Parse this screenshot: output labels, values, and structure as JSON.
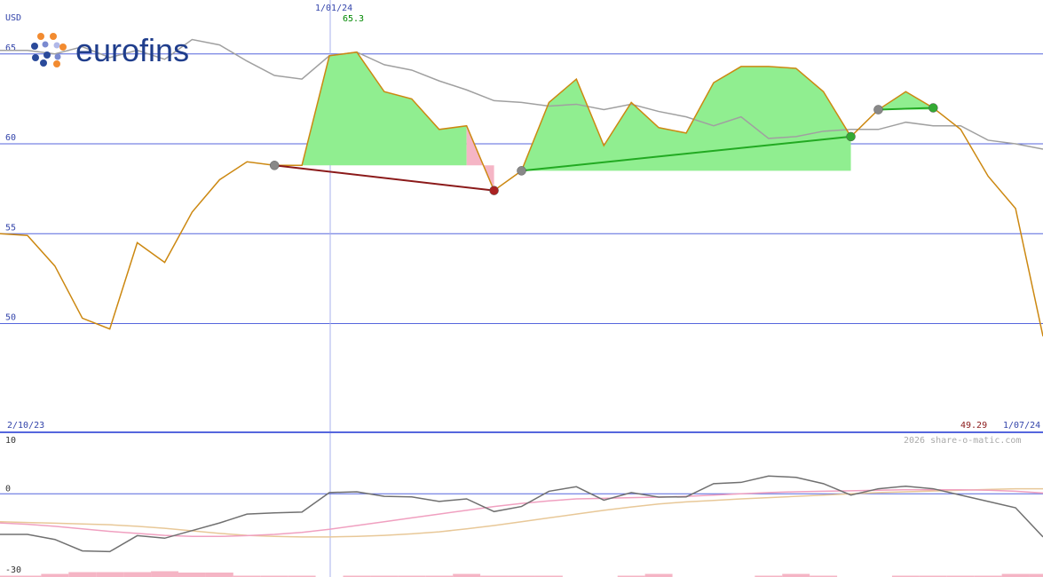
{
  "chart_data": [
    {
      "type": "line",
      "title": "",
      "currency": "USD",
      "ylim": [
        44,
        68
      ],
      "yticks": [
        "65",
        "60",
        "55",
        "50"
      ],
      "ytick_values": [
        65,
        60,
        55,
        50
      ],
      "date_start": "2/10/23",
      "date_end": "1/07/24",
      "marker_date": "1/01/24",
      "marker_value": "65.3",
      "last_value": "49.29",
      "watermark": "2026 share-o-matic.com",
      "series": [
        {
          "role": "price",
          "color": "#cc8811",
          "values": [
            55.0,
            54.9,
            53.2,
            50.3,
            49.7,
            54.5,
            53.4,
            56.2,
            58.0,
            59.0,
            58.8,
            58.8,
            64.9,
            65.1,
            62.9,
            62.5,
            60.8,
            61.0,
            57.4,
            58.5,
            62.3,
            63.6,
            59.9,
            62.3,
            60.9,
            60.6,
            63.4,
            64.3,
            64.3,
            64.2,
            62.9,
            60.4,
            61.9,
            62.9,
            62.0,
            60.8,
            58.2,
            56.4,
            49.29
          ]
        },
        {
          "role": "moving-average",
          "color": "#a0a0a0",
          "values": [
            65.2,
            65.2,
            65.0,
            65.4,
            64.8,
            65.2,
            64.7,
            65.8,
            65.5,
            64.6,
            63.8,
            63.6,
            64.9,
            65.1,
            64.4,
            64.1,
            63.5,
            63.0,
            62.4,
            62.3,
            62.1,
            62.2,
            61.9,
            62.2,
            61.8,
            61.5,
            61.0,
            61.5,
            60.3,
            60.4,
            60.7,
            60.8,
            60.8,
            61.2,
            61.0,
            61.0,
            60.2,
            60.0,
            59.7
          ]
        }
      ],
      "trend_lines": [
        {
          "from_index": 10,
          "to_index": 18,
          "from_value": 58.8,
          "to_value": 57.4,
          "color": "#8b1a1a"
        },
        {
          "from_index": 19,
          "to_index": 31,
          "from_value": 58.5,
          "to_value": 60.4,
          "color": "#22aa22"
        },
        {
          "from_index": 32,
          "to_index": 34,
          "from_value": 61.9,
          "to_value": 62.0,
          "color": "#22aa22"
        }
      ],
      "markers": [
        {
          "index": 10,
          "value": 58.8,
          "color": "#888888"
        },
        {
          "index": 18,
          "value": 57.4,
          "color": "#aa2222"
        },
        {
          "index": 19,
          "value": 58.5,
          "color": "#888888"
        },
        {
          "index": 31,
          "value": 60.4,
          "color": "#33aa33"
        },
        {
          "index": 32,
          "value": 61.9,
          "color": "#888888"
        },
        {
          "index": 34,
          "value": 62.0,
          "color": "#33aa33"
        }
      ],
      "fill_zones": [
        {
          "from_index": 11,
          "to_index": 17,
          "base": 58.8,
          "color": "#90ee90"
        },
        {
          "from_index": 17,
          "to_index": 18,
          "base": 58.8,
          "color": "#f5b5c5"
        },
        {
          "from_index": 19,
          "to_index": 31,
          "base": 58.5,
          "color": "#90ee90"
        },
        {
          "from_index": 32,
          "to_index": 34,
          "base": 61.9,
          "color": "#90ee90"
        }
      ]
    },
    {
      "type": "line",
      "title": "",
      "ylim": [
        -30,
        12
      ],
      "yticks": [
        "10",
        "0",
        "-30"
      ],
      "ytick_values": [
        10,
        0,
        -30
      ],
      "series": [
        {
          "role": "oscillator",
          "color": "#707070",
          "values": [
            -16.0,
            -16.0,
            -18.0,
            -22.5,
            -22.8,
            -16.5,
            -17.5,
            -14.5,
            -11.5,
            -8.0,
            -7.5,
            -7.2,
            0.5,
            0.8,
            -1.0,
            -1.2,
            -3.0,
            -2.0,
            -7.0,
            -5.0,
            1.0,
            2.8,
            -2.5,
            0.5,
            -1.3,
            -1.2,
            4.0,
            4.5,
            7.0,
            6.5,
            4.0,
            -0.5,
            2.0,
            3.0,
            2.0,
            -0.5,
            -3.0,
            -5.5,
            -17.0
          ]
        },
        {
          "role": "signal",
          "color": "#f0a0c0",
          "values": [
            -11.5,
            -12.0,
            -12.8,
            -13.8,
            -14.8,
            -15.6,
            -16.4,
            -16.8,
            -16.8,
            -16.5,
            -16.0,
            -15.2,
            -14.0,
            -12.5,
            -11.0,
            -9.5,
            -8.0,
            -6.5,
            -5.0,
            -3.8,
            -2.8,
            -2.0,
            -1.8,
            -1.5,
            -1.3,
            -1.0,
            -0.5,
            0.0,
            0.5,
            0.8,
            1.0,
            1.2,
            1.4,
            1.6,
            1.6,
            1.6,
            1.4,
            1.0,
            0.3
          ]
        },
        {
          "role": "slow-average",
          "color": "#e8c898",
          "values": [
            -11.0,
            -11.3,
            -11.6,
            -11.9,
            -12.2,
            -12.8,
            -13.6,
            -14.6,
            -15.6,
            -16.4,
            -16.8,
            -17.0,
            -17.0,
            -16.8,
            -16.4,
            -15.8,
            -15.0,
            -13.8,
            -12.5,
            -11.0,
            -9.5,
            -8.0,
            -6.5,
            -5.2,
            -4.0,
            -3.2,
            -2.6,
            -2.0,
            -1.5,
            -1.0,
            -0.5,
            0.0,
            0.5,
            0.8,
            1.1,
            1.4,
            1.7,
            2.0,
            2.0
          ]
        }
      ],
      "volume": [
        1.5,
        1.5,
        3.5,
        5.5,
        5.5,
        5.5,
        6.5,
        5.0,
        5.0,
        1.5,
        1.5,
        1.5,
        0.0,
        1.5,
        1.5,
        1.5,
        1.5,
        3.5,
        1.5,
        1.5,
        1.5,
        0.0,
        0.0,
        1.5,
        3.5,
        0.0,
        0.0,
        0.0,
        1.5,
        3.5,
        1.5,
        0.0,
        0.0,
        1.5,
        1.5,
        1.5,
        1.5,
        3.5,
        3.5
      ]
    }
  ],
  "colors": {
    "grid": "#5566dd",
    "tick_text": "#3344aa",
    "marker_line": "#aab0ee",
    "marker_value_text": "#008800",
    "last_value_text": "#8b1a1a",
    "watermark_text": "#aaaaaa",
    "volume": "#f5b5c5"
  },
  "logo": {
    "icon": "eurofins-dots-icon",
    "text": "eurofins"
  }
}
